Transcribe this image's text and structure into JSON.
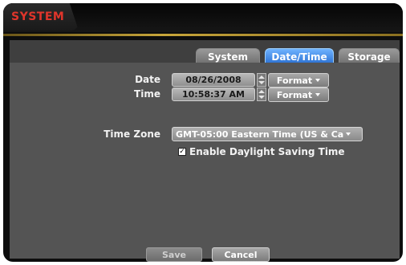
{
  "window": {
    "title": "SYSTEM"
  },
  "tabs": [
    {
      "label": "System",
      "active": false
    },
    {
      "label": "Date/Time",
      "active": true
    },
    {
      "label": "Storage",
      "active": false
    }
  ],
  "date": {
    "label": "Date",
    "value": "08/26/2008",
    "format_label": "Format"
  },
  "time": {
    "label": "Time",
    "value": "10:58:37 AM",
    "format_label": "Format"
  },
  "timezone": {
    "label": "Time Zone",
    "value": "GMT-05:00  Eastern Time (US & Ca"
  },
  "dst": {
    "label": "Enable Daylight Saving Time",
    "checked": true
  },
  "buttons": {
    "save": "Save",
    "cancel": "Cancel"
  },
  "colors": {
    "title": "#e0352b",
    "accent_gold": "#c8a63a",
    "active_tab": "#2a6fd1",
    "panel": "#545454"
  }
}
